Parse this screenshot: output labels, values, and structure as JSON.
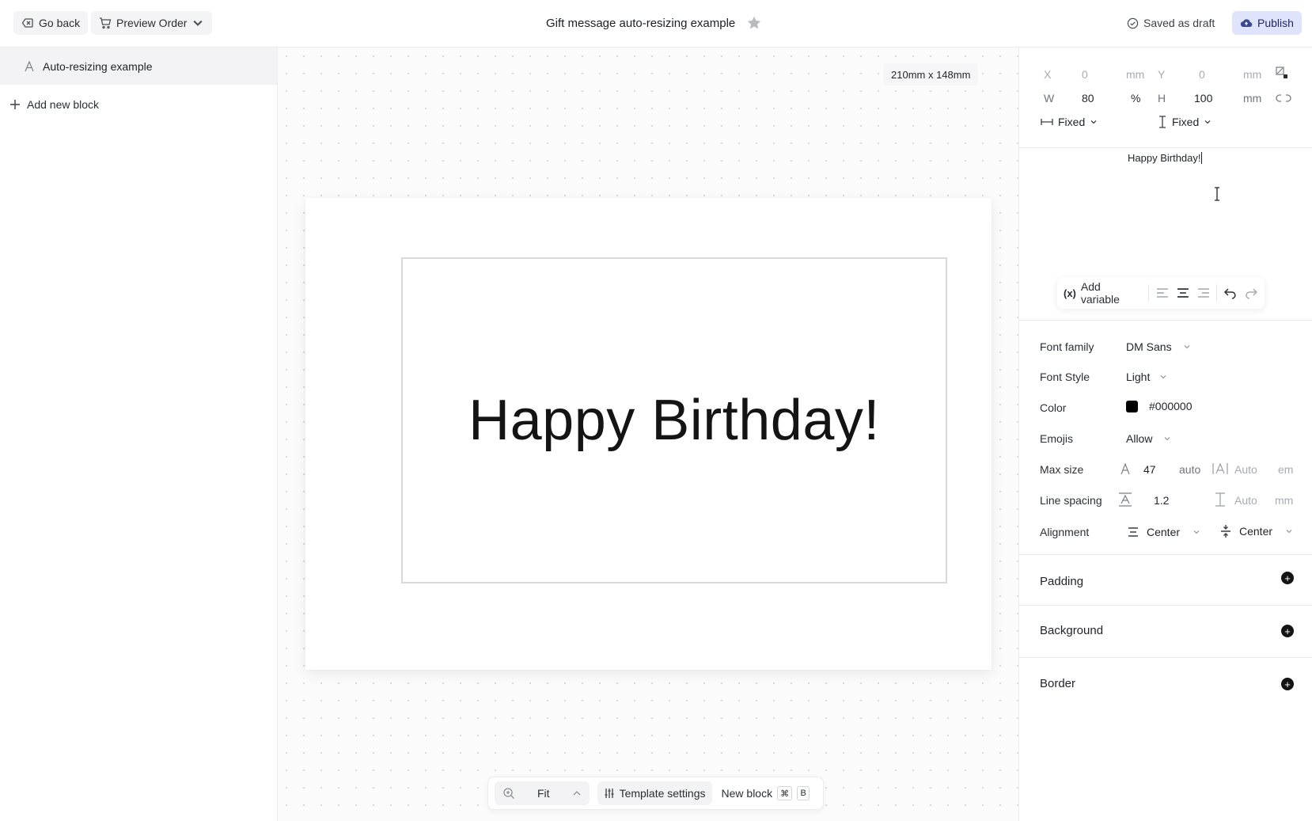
{
  "topbar": {
    "back_label": "Go back",
    "preview_label": "Preview Order",
    "title": "Gift message auto-resizing example",
    "saved_label": "Saved as draft",
    "publish_label": "Publish"
  },
  "sidebar": {
    "items": [
      {
        "label": "Auto-resizing example"
      }
    ],
    "add_label": "Add new block"
  },
  "canvas": {
    "size_label": "210mm x 148mm",
    "text": "Happy Birthday!"
  },
  "bottom_toolbar": {
    "zoom_label": "Fit",
    "template_settings_label": "Template settings",
    "new_block_label": "New block",
    "shortcut_keys": [
      "⌘",
      "B"
    ]
  },
  "geometry": {
    "x": {
      "label": "X",
      "value": "0",
      "unit": "mm"
    },
    "y": {
      "label": "Y",
      "value": "0",
      "unit": "mm"
    },
    "w": {
      "label": "W",
      "value": "80",
      "unit": "%"
    },
    "h": {
      "label": "H",
      "value": "100",
      "unit": "mm"
    },
    "width_mode": "Fixed",
    "height_mode": "Fixed"
  },
  "editor": {
    "text": "Happy Birthday!",
    "add_variable_label": "Add variable",
    "variable_glyph": "(x)"
  },
  "properties": {
    "font_family": {
      "label": "Font family",
      "value": "DM Sans"
    },
    "font_style": {
      "label": "Font Style",
      "value": "Light"
    },
    "color": {
      "label": "Color",
      "value": "#000000"
    },
    "emojis": {
      "label": "Emojis",
      "value": "Allow"
    },
    "max_size": {
      "label": "Max size",
      "value": "47",
      "mode": "auto",
      "secondary": "Auto",
      "unit": "em"
    },
    "line_spacing": {
      "label": "Line spacing",
      "value": "1.2",
      "secondary": "Auto",
      "unit": "mm"
    },
    "alignment": {
      "label": "Alignment",
      "horizontal": "Center",
      "vertical": "Center"
    }
  },
  "sections": {
    "padding": "Padding",
    "background": "Background",
    "border": "Border"
  },
  "colors": {
    "publish_bg": "#dfe3fb",
    "accent": "#1e2a66"
  }
}
